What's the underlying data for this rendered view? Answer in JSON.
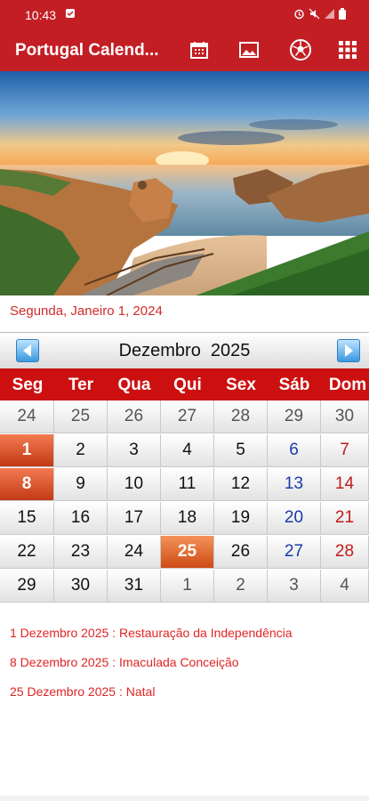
{
  "status_bar": {
    "time": "10:43"
  },
  "app_bar": {
    "title": "Portugal Calend...",
    "actions": [
      "calendar-icon",
      "image-icon",
      "soccer-ball-icon",
      "grid-icon"
    ]
  },
  "selected_date": "Segunda, Janeiro 1, 2024",
  "calendar": {
    "month_label": "Dezembro  2025",
    "weekdays": [
      "Seg",
      "Ter",
      "Qua",
      "Qui",
      "Sex",
      "Sáb",
      "Dom"
    ],
    "weeks": [
      [
        "24",
        "25",
        "26",
        "27",
        "28",
        "29",
        "30"
      ],
      [
        "1",
        "2",
        "3",
        "4",
        "5",
        "6",
        "7"
      ],
      [
        "8",
        "9",
        "10",
        "11",
        "12",
        "13",
        "14"
      ],
      [
        "15",
        "16",
        "17",
        "18",
        "19",
        "20",
        "21"
      ],
      [
        "22",
        "23",
        "24",
        "25",
        "26",
        "27",
        "28"
      ],
      [
        "29",
        "30",
        "31",
        "1",
        "2",
        "3",
        "4"
      ]
    ],
    "holiday_days": [
      "1",
      "8",
      "25"
    ]
  },
  "holidays": [
    "1 Dezembro 2025 : Restauração da Independência",
    "8 Dezembro 2025 : Imaculada Conceição",
    "25 Dezembro 2025 : Natal"
  ],
  "colors": {
    "primary": "#c21e24",
    "weekday_header": "#cc1010",
    "holiday_text": "#e02424",
    "saturday": "#1c3aa9",
    "sunday": "#c21a1a"
  }
}
